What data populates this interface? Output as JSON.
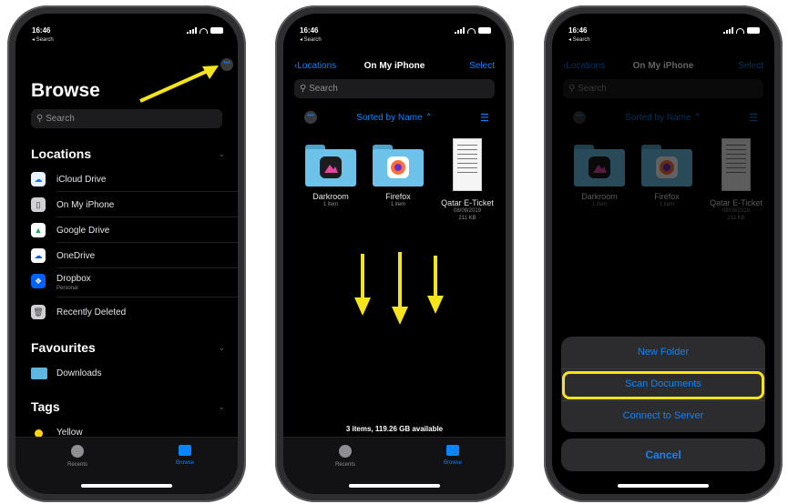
{
  "colors": {
    "accent": "#0a84ff",
    "highlight": "#f5e31b",
    "background": "#000000"
  },
  "status": {
    "time": "16:46",
    "back": "◂ Search"
  },
  "phone1": {
    "title": "Browse",
    "search_placeholder": "Search",
    "locations_header": "Locations",
    "locations": [
      {
        "label": "iCloud Drive",
        "icon": "icloud-icon"
      },
      {
        "label": "On My iPhone",
        "icon": "iphone-icon"
      },
      {
        "label": "Google Drive",
        "icon": "google-drive-icon"
      },
      {
        "label": "OneDrive",
        "icon": "onedrive-icon"
      },
      {
        "label": "Dropbox",
        "sub": "Personal",
        "icon": "dropbox-icon"
      },
      {
        "label": "Recently Deleted",
        "icon": "trash-icon"
      }
    ],
    "favourites_header": "Favourites",
    "favourites": [
      {
        "label": "Downloads",
        "icon": "folder-icon"
      }
    ],
    "tags_header": "Tags",
    "tags": [
      {
        "label": "Yellow",
        "color": "#ffd60a"
      }
    ],
    "tabs": [
      {
        "label": "Recents"
      },
      {
        "label": "Browse"
      }
    ]
  },
  "phone2": {
    "back_label": "Locations",
    "title": "On My iPhone",
    "select_label": "Select",
    "search_placeholder": "Search",
    "sort_label": "Sorted by Name ⌃",
    "files": [
      {
        "name": "Darkroom",
        "meta1": "1 item",
        "meta2": ""
      },
      {
        "name": "Firefox",
        "meta1": "1 item",
        "meta2": ""
      },
      {
        "name": "Qatar E-Ticket",
        "meta1": "08/09/2019",
        "meta2": "211 KB"
      }
    ],
    "footer": "3 items, 119.26 GB available",
    "tabs": [
      {
        "label": "Recents"
      },
      {
        "label": "Browse"
      }
    ]
  },
  "phone3": {
    "sheet": {
      "new_folder": "New Folder",
      "scan_documents": "Scan Documents",
      "connect_server": "Connect to Server",
      "cancel": "Cancel"
    }
  }
}
